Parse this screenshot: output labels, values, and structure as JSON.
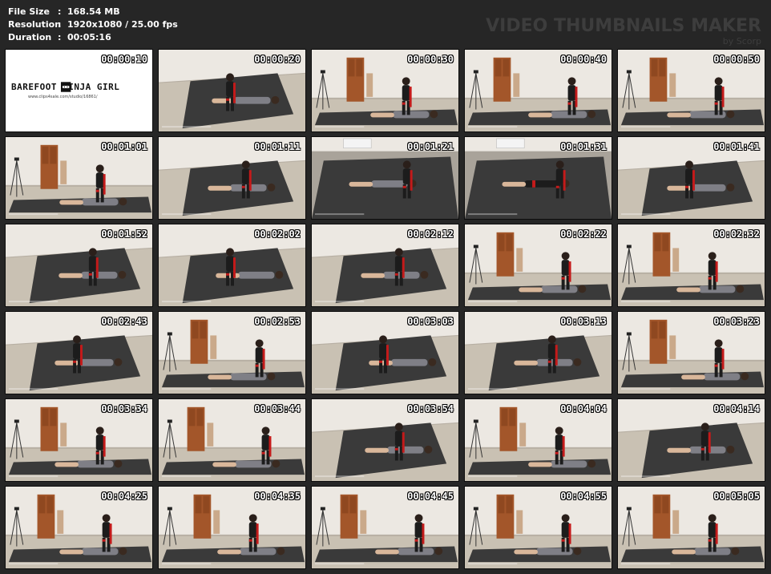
{
  "info": {
    "rows": [
      {
        "label": "File Size",
        "value": "168.54 MB"
      },
      {
        "label": "Resolution",
        "value": "1920x1080 / 25.00 fps"
      },
      {
        "label": "Duration",
        "value": "00:05:16"
      }
    ]
  },
  "watermark": {
    "title": "VIDEO THUMBNAILS MAKER",
    "by": "by Scorp"
  },
  "title_card": {
    "brand": "BAREFOOT NINJA GIRL",
    "url": "www.clips4sale.com/studio/16861/",
    "icons": [
      "feet-icon",
      "ninja-icon"
    ]
  },
  "thumbnails": [
    {
      "time": "00:00:10",
      "scene": "title"
    },
    {
      "time": "00:00:20",
      "scene": "mat"
    },
    {
      "time": "00:00:30",
      "scene": "door"
    },
    {
      "time": "00:00:40",
      "scene": "door"
    },
    {
      "time": "00:00:50",
      "scene": "door"
    },
    {
      "time": "00:01:01",
      "scene": "door"
    },
    {
      "time": "00:01:11",
      "scene": "mat"
    },
    {
      "time": "00:01:21",
      "scene": "close"
    },
    {
      "time": "00:01:31",
      "scene": "close"
    },
    {
      "time": "00:01:41",
      "scene": "mat"
    },
    {
      "time": "00:01:52",
      "scene": "mat"
    },
    {
      "time": "00:02:02",
      "scene": "mat"
    },
    {
      "time": "00:02:12",
      "scene": "mat"
    },
    {
      "time": "00:02:22",
      "scene": "door"
    },
    {
      "time": "00:02:32",
      "scene": "door"
    },
    {
      "time": "00:02:43",
      "scene": "mat"
    },
    {
      "time": "00:02:53",
      "scene": "door"
    },
    {
      "time": "00:03:03",
      "scene": "mat"
    },
    {
      "time": "00:03:13",
      "scene": "mat"
    },
    {
      "time": "00:03:23",
      "scene": "door"
    },
    {
      "time": "00:03:34",
      "scene": "door"
    },
    {
      "time": "00:03:44",
      "scene": "door"
    },
    {
      "time": "00:03:54",
      "scene": "mat"
    },
    {
      "time": "00:04:04",
      "scene": "door"
    },
    {
      "time": "00:04:14",
      "scene": "mat"
    },
    {
      "time": "00:04:25",
      "scene": "door"
    },
    {
      "time": "00:04:35",
      "scene": "door"
    },
    {
      "time": "00:04:45",
      "scene": "door"
    },
    {
      "time": "00:04:55",
      "scene": "door"
    },
    {
      "time": "00:05:05",
      "scene": "door"
    }
  ],
  "colors": {
    "background": "#262626",
    "wall": "#ece8e2",
    "floor": "#c9c1b3",
    "mat": "#3a3a3a",
    "door": "#a3562a",
    "accent_red": "#c41a1a",
    "watermark": "#3d3d3d"
  }
}
